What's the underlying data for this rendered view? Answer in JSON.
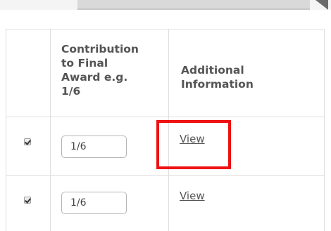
{
  "table": {
    "headers": {
      "contribution": [
        "Contribution",
        "to Final",
        "Award e.g.",
        "1/6"
      ],
      "additional_info": [
        "Additional",
        "Information"
      ]
    },
    "rows": [
      {
        "selected": true,
        "contribution_value": "1/6",
        "link_label": "View"
      },
      {
        "selected": true,
        "contribution_value": "1/6",
        "link_label": "View"
      }
    ]
  },
  "annotation": {
    "highlight_color": "#ee1111",
    "highlight_target": "row-1-view-link"
  }
}
